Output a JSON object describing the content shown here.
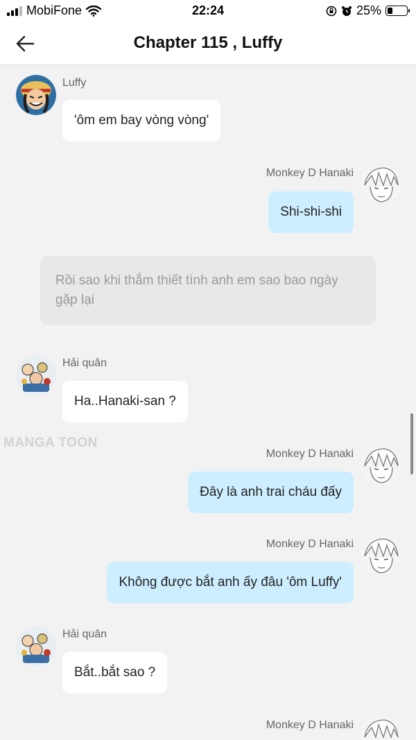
{
  "status_bar": {
    "carrier": "MobiFone",
    "time": "22:24",
    "battery": "25%",
    "battery_level": 0.25,
    "icons": [
      "signal-icon",
      "wifi-icon",
      "rotation-lock-icon",
      "alarm-icon",
      "battery-icon"
    ]
  },
  "header": {
    "title": "Chapter 115 , Luffy",
    "back_icon": "arrow-left-icon"
  },
  "messages": [
    {
      "sender": "Luffy",
      "side": "left",
      "text": "'ôm em bay vòng vòng'"
    },
    {
      "sender": "Monkey D Hanaki",
      "side": "right",
      "text": "Shi-shi-shi"
    },
    {
      "type": "narration",
      "text": "Rồi sao khi thắm thiết tình anh em sao bao ngày gặp lại"
    },
    {
      "sender": "Hải quân",
      "side": "left",
      "text": "Ha..Hanaki-san ?"
    },
    {
      "sender": "Monkey D Hanaki",
      "side": "right",
      "text": "Đây là anh trai cháu đấy"
    },
    {
      "sender": "Monkey D Hanaki",
      "side": "right",
      "text": "Không được bắt anh ấy đâu 'ôm Luffy'"
    },
    {
      "sender": "Hải quân",
      "side": "left",
      "text": "Bắt..bắt sao ?"
    },
    {
      "sender": "Monkey D Hanaki",
      "side": "right",
      "text": ""
    }
  ],
  "watermark": "MANGA TOON",
  "colors": {
    "background": "#f2f2f2",
    "bubble_left": "#ffffff",
    "bubble_right": "#cdeeff",
    "narration": "#e8e8e8"
  }
}
